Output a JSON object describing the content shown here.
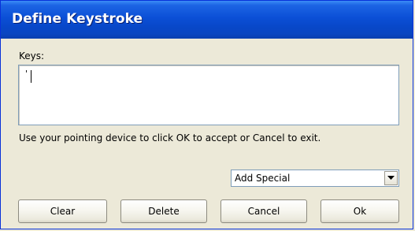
{
  "window": {
    "title": "Define Keystroke"
  },
  "keys": {
    "label": "Keys:",
    "value": "'"
  },
  "instruction": "Use your pointing device to click OK to accept or Cancel to exit.",
  "add_special": {
    "selected": "Add Special",
    "icon": "chevron-down-icon"
  },
  "buttons": {
    "clear": "Clear",
    "delete": "Delete",
    "cancel": "Cancel",
    "ok": "Ok"
  },
  "colors": {
    "titlebar": "#0b4fd6",
    "dialog_background": "#ece9d8",
    "title_text": "#ffffff"
  }
}
